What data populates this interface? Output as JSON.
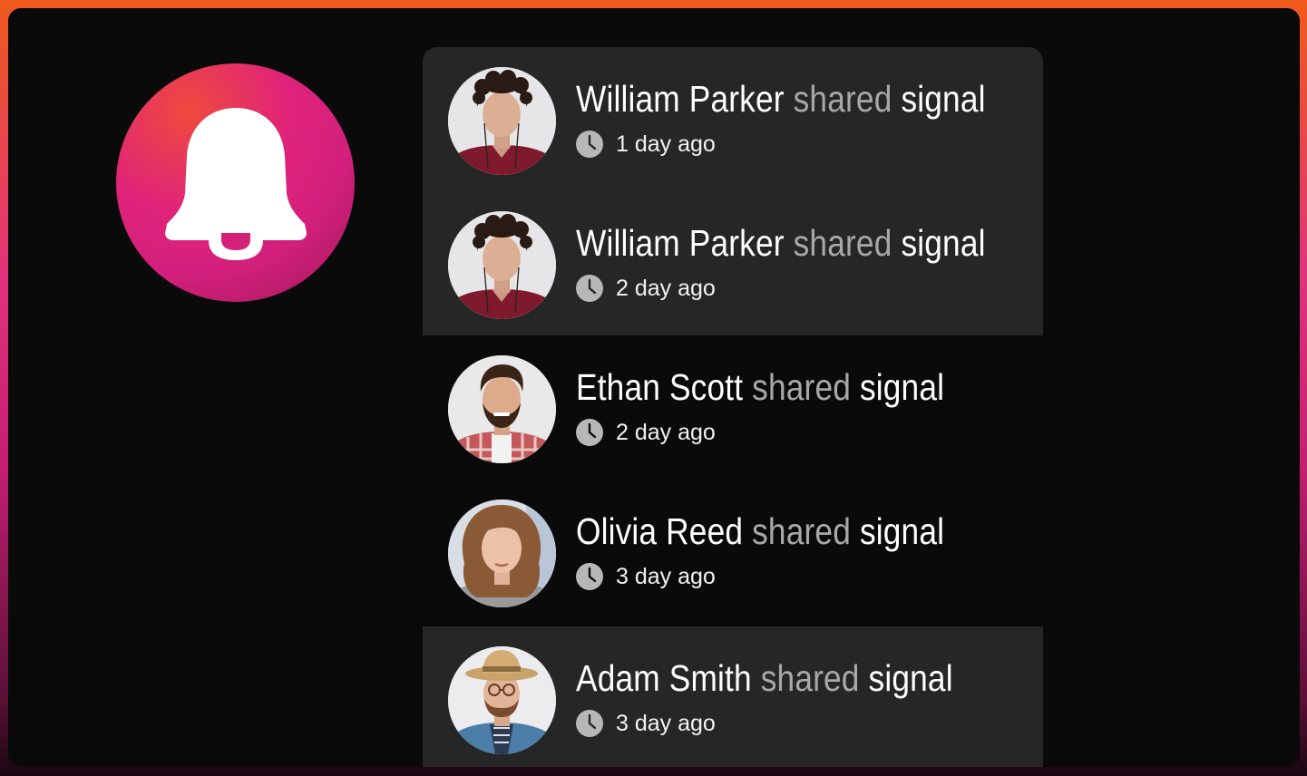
{
  "colors": {
    "frame_gradient_top": "#ef5a1c",
    "frame_gradient_mid": "#e2337a",
    "panel_bg": "#0a0a0a",
    "highlight_row_bg": "#262626",
    "badge_accent": "#e0237a",
    "verb_text": "#a8a8a8"
  },
  "badge": {
    "icon": "bell-icon"
  },
  "notifications": [
    {
      "name": "William Parker",
      "verb": "shared",
      "object": "signal",
      "time": "1 day ago",
      "avatar": "curly-hair-man-avatar",
      "highlighted": true
    },
    {
      "name": "William Parker",
      "verb": "shared",
      "object": "signal",
      "time": "2 day ago",
      "avatar": "curly-hair-man-avatar",
      "highlighted": true
    },
    {
      "name": "Ethan Scott",
      "verb": "shared",
      "object": "signal",
      "time": "2 day ago",
      "avatar": "bearded-man-avatar",
      "highlighted": false
    },
    {
      "name": "Olivia Reed",
      "verb": "shared",
      "object": "signal",
      "time": "3 day ago",
      "avatar": "woman-avatar",
      "highlighted": false
    },
    {
      "name": "Adam Smith",
      "verb": "shared",
      "object": "signal",
      "time": "3 day ago",
      "avatar": "hat-man-avatar",
      "highlighted": true
    }
  ]
}
